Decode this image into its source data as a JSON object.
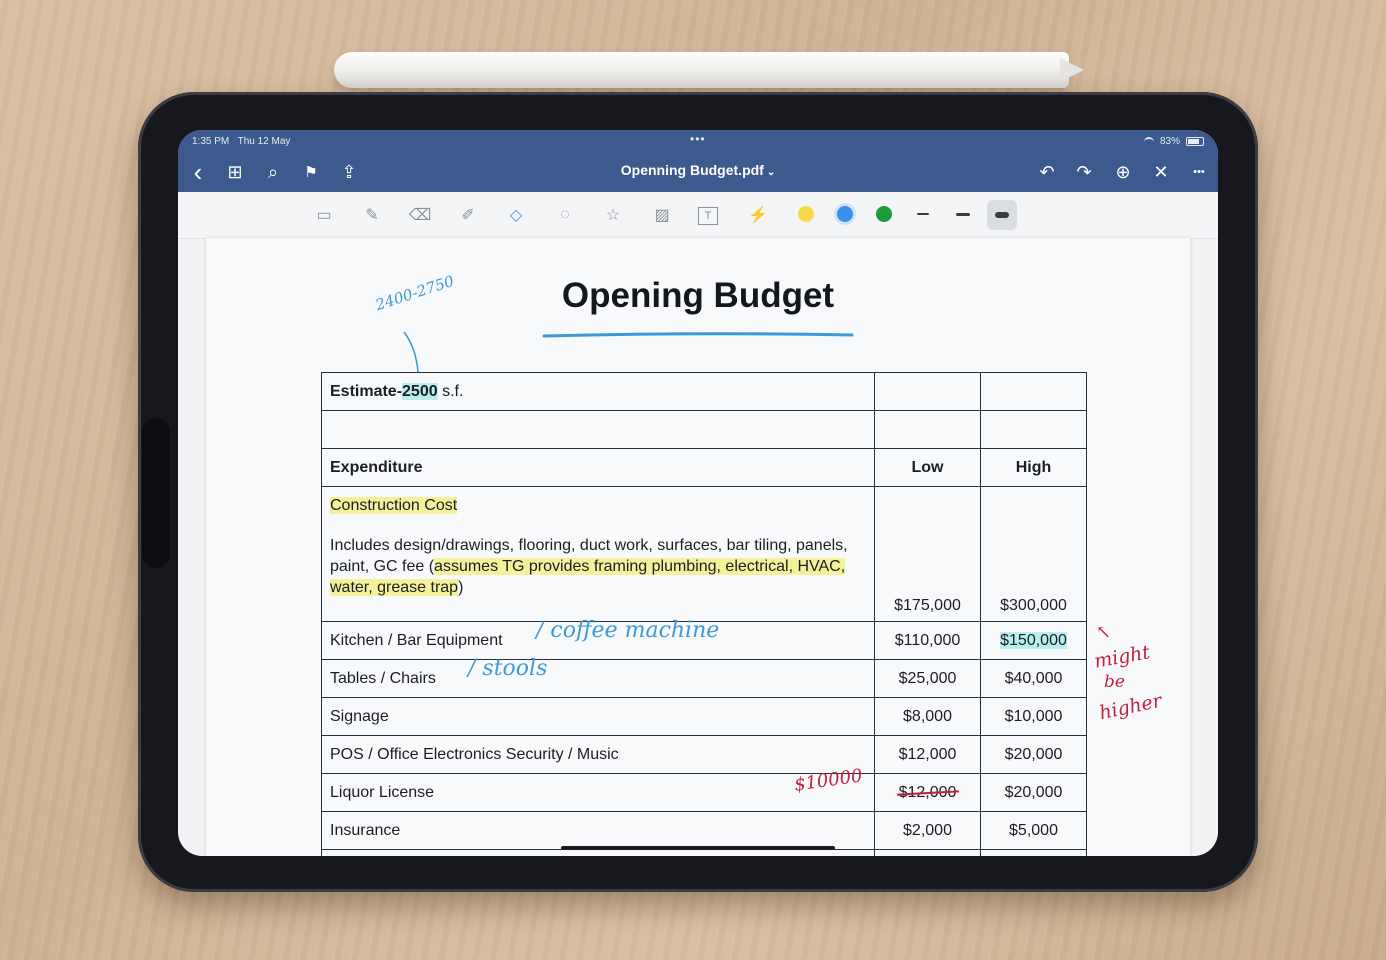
{
  "status": {
    "time": "1:35 PM",
    "date": "Thu 12 May",
    "dots": "•••",
    "battery": "83%"
  },
  "nav": {
    "title": "Openning Budget.pdf",
    "title_chevron": "⌄",
    "icons": [
      "back-icon",
      "grid-icon",
      "search-icon",
      "bookmark-icon",
      "share-icon",
      "undo-icon",
      "redo-icon",
      "add-page-icon",
      "close-icon",
      "more-icon"
    ],
    "glyphs": {
      "back": "‹",
      "grid": "⊞",
      "search": "⌕",
      "bookmark": "⚑",
      "share": "⇪",
      "undo": "↶",
      "redo": "↷",
      "addpage": "⊕",
      "close": "✕",
      "more": "•••"
    }
  },
  "toolbar": {
    "tools": [
      "read-mode-icon",
      "pen-icon",
      "eraser-icon",
      "highlighter-icon",
      "shapes-icon",
      "lasso-icon",
      "sticker-icon",
      "image-icon",
      "text-box-icon",
      "laser-pointer-icon"
    ],
    "glyphs": {
      "read": "▭",
      "pen": "✎",
      "eraser": "⌫",
      "highlighter": "✐",
      "shapes": "◇",
      "lasso": "◌",
      "sticker": "☆",
      "image": "▨",
      "text": "T",
      "laser": "⚡"
    },
    "colors": [
      "#f5d94a",
      "#3d8ee8",
      "#1e9a3a"
    ]
  },
  "document": {
    "title": "Opening Budget",
    "estimate_prefix": "Estimate-",
    "estimate_value": "2500",
    "estimate_suffix": " s.f.",
    "col_expenditure": "Expenditure",
    "col_low": "Low",
    "col_high": "High",
    "construction_label": "Construction Cost",
    "construction_desc_plain": "Includes design/drawings, flooring, duct work, surfaces, bar tiling, panels, paint, GC fee (",
    "construction_desc_hl": "assumes TG provides framing plumbing, electrical, HVAC, water, grease trap",
    "construction_desc_end": ")",
    "construction_low": "$175,000",
    "construction_high": "$300,000",
    "rows": [
      {
        "label": "Kitchen / Bar Equipment",
        "low": "$110,000",
        "high": "$150,000"
      },
      {
        "label": "Tables / Chairs",
        "low": "$25,000",
        "high": "$40,000"
      },
      {
        "label": "Signage",
        "low": "$8,000",
        "high": "$10,000"
      },
      {
        "label": "POS / Office Electronics Security / Music",
        "low": "$12,000",
        "high": "$20,000"
      },
      {
        "label": "Liquor License",
        "low": "$12,000",
        "high": "$20,000"
      },
      {
        "label": "Insurance",
        "low": "$2,000",
        "high": "$5,000"
      }
    ]
  },
  "annotations": {
    "range": "2400-2750",
    "coffee": "/ coffee machine",
    "stools": "/ stools",
    "liquor": "$10000",
    "arrow": "↖",
    "might": "might",
    "be": "be",
    "higher": "higher"
  }
}
